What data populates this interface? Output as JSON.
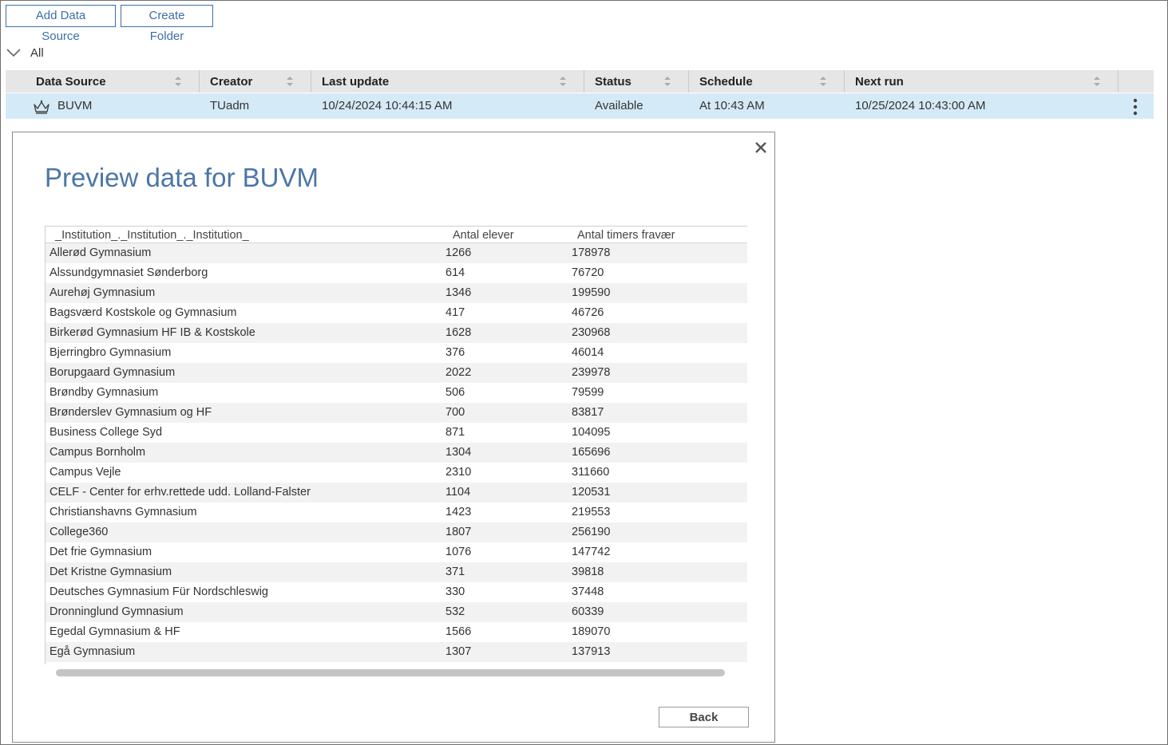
{
  "toolbar": {
    "add_data_source": "Add Data Source",
    "create_folder": "Create Folder"
  },
  "group": {
    "label": "All"
  },
  "grid": {
    "columns": [
      "Data Source",
      "Creator",
      "Last update",
      "Status",
      "Schedule",
      "Next run"
    ],
    "row": {
      "data_source": "BUVM",
      "creator": "TUadm",
      "last_update": "10/24/2024 10:44:15 AM",
      "status": "Available",
      "schedule": "At 10:43 AM",
      "next_run": "10/25/2024 10:43:00 AM"
    }
  },
  "dialog": {
    "title": "Preview data for BUVM",
    "back_label": "Back",
    "columns": [
      "_Institution_._Institution_._Institution_",
      "Antal elever",
      "Antal timers fravær"
    ],
    "rows": [
      [
        "Allerød Gymnasium",
        "1266",
        "178978"
      ],
      [
        "Alssundgymnasiet Sønderborg",
        "614",
        "76720"
      ],
      [
        "Aurehøj Gymnasium",
        "1346",
        "199590"
      ],
      [
        "Bagsværd Kostskole og Gymnasium",
        "417",
        "46726"
      ],
      [
        "Birkerød Gymnasium HF IB & Kostskole",
        "1628",
        "230968"
      ],
      [
        "Bjerringbro Gymnasium",
        "376",
        "46014"
      ],
      [
        "Borupgaard Gymnasium",
        "2022",
        "239978"
      ],
      [
        "Brøndby Gymnasium",
        "506",
        "79599"
      ],
      [
        "Brønderslev Gymnasium og HF",
        "700",
        "83817"
      ],
      [
        "Business College Syd",
        "871",
        "104095"
      ],
      [
        "Campus Bornholm",
        "1304",
        "165696"
      ],
      [
        "Campus Vejle",
        "2310",
        "311660"
      ],
      [
        "CELF - Center for erhv.rettede udd. Lolland-Falster",
        "1104",
        "120531"
      ],
      [
        "Christianshavns Gymnasium",
        "1423",
        "219553"
      ],
      [
        "College360",
        "1807",
        "256190"
      ],
      [
        "Det frie Gymnasium",
        "1076",
        "147742"
      ],
      [
        "Det Kristne Gymnasium",
        "371",
        "39818"
      ],
      [
        "Deutsches Gymnasium Für Nordschleswig",
        "330",
        "37448"
      ],
      [
        "Dronninglund Gymnasium",
        "532",
        "60339"
      ],
      [
        "Egedal Gymnasium & HF",
        "1566",
        "189070"
      ],
      [
        "Egå Gymnasium",
        "1307",
        "137913"
      ]
    ]
  },
  "colors": {
    "accent": "#3b6ea8",
    "title": "#4b76a8",
    "selected_row": "#d5eaf7",
    "header_bg": "#e6e6e6",
    "stripe": "#f2f2f2"
  },
  "icons": [
    "chevron-down-icon",
    "sort-icon",
    "crown-icon",
    "kebab-menu-icon",
    "close-icon"
  ]
}
